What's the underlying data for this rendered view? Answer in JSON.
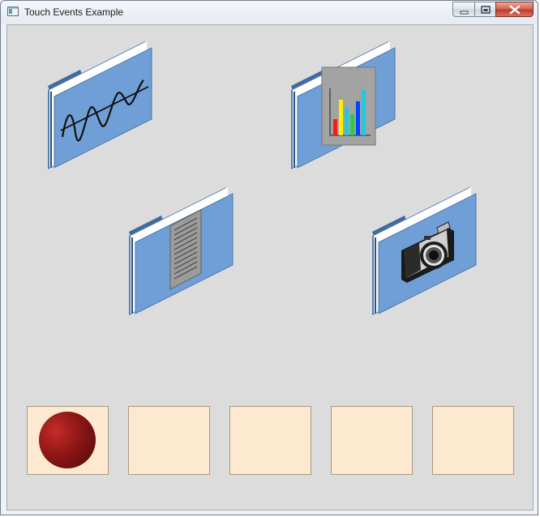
{
  "window": {
    "title": "Touch Events Example",
    "controls": [
      "minimize",
      "maximize",
      "close"
    ]
  },
  "folders": [
    {
      "id": "waveform",
      "content_icon": "waveform-icon"
    },
    {
      "id": "chart",
      "content_icon": "bar-chart-icon"
    },
    {
      "id": "document",
      "content_icon": "document-icon"
    },
    {
      "id": "camera",
      "content_icon": "camera-icon"
    }
  ],
  "slots": {
    "count": 5,
    "filled_slot": 1,
    "filled_item": "red-ball"
  },
  "colors": {
    "client_background": "#dcdcdc",
    "slot_fill": "#fde9cf",
    "folder_blue": "#6f9fd6",
    "ball_red": "#8e1616"
  }
}
